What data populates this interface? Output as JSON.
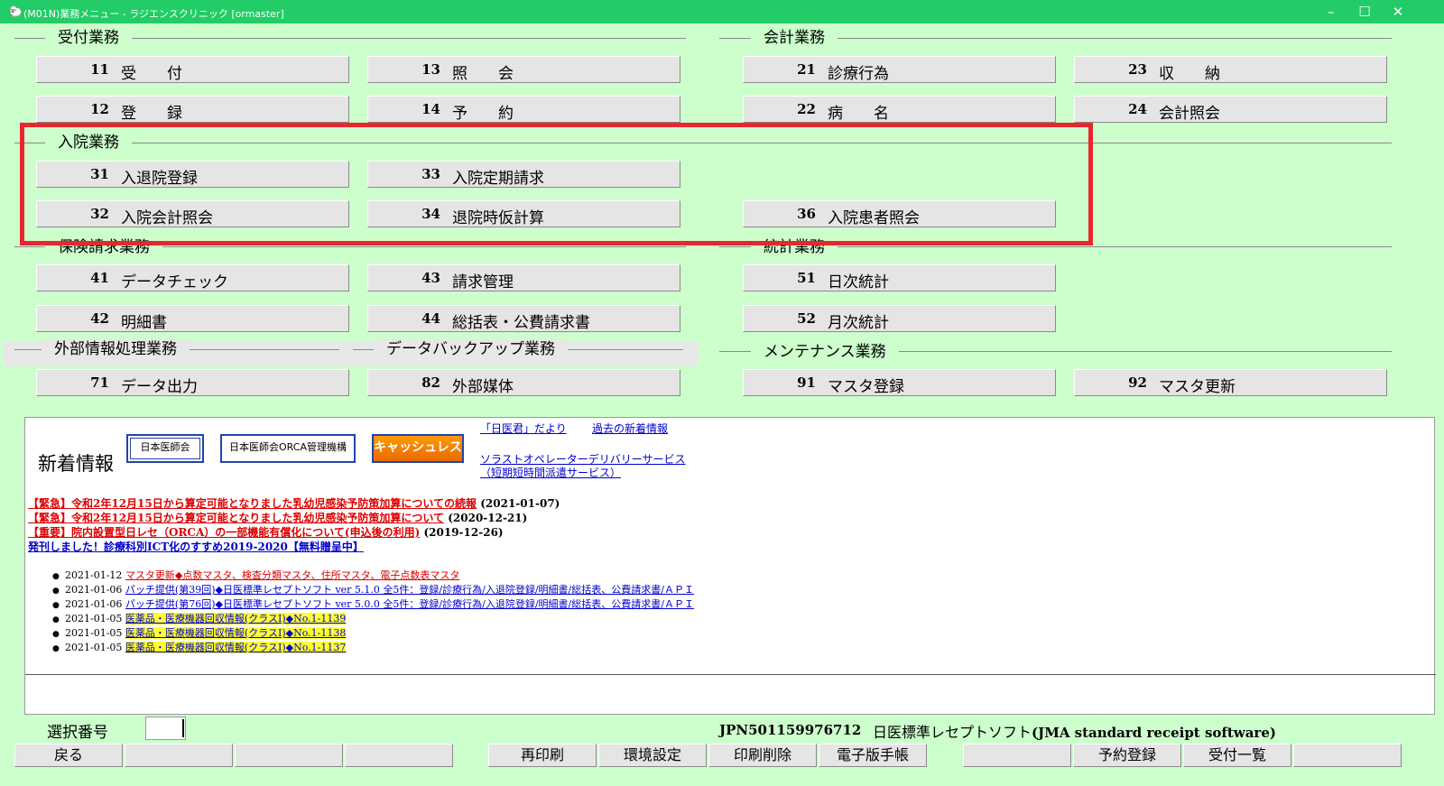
{
  "window": {
    "title": "(M01N)業務メニュー - ラジエンスクリニック [ormaster]",
    "minimize": "–",
    "maximize": "☐",
    "close": "✕"
  },
  "sections": {
    "uketsuke": "受付業務",
    "kaikei": "会計業務",
    "nyuin": "入院業務",
    "hoken": "保険請求業務",
    "tokei": "統計業務",
    "gaibu": "外部情報処理業務",
    "backup": "データバックアップ業務",
    "maintenance": "メンテナンス業務"
  },
  "buttons": {
    "b11": {
      "num": "11",
      "label": "受　　付"
    },
    "b13": {
      "num": "13",
      "label": "照　　会"
    },
    "b21": {
      "num": "21",
      "label": "診療行為"
    },
    "b23": {
      "num": "23",
      "label": "収　　納"
    },
    "b12": {
      "num": "12",
      "label": "登　　録"
    },
    "b14": {
      "num": "14",
      "label": "予　　約"
    },
    "b22": {
      "num": "22",
      "label": "病　　名"
    },
    "b24": {
      "num": "24",
      "label": "会計照会"
    },
    "b31": {
      "num": "31",
      "label": "入退院登録"
    },
    "b33": {
      "num": "33",
      "label": "入院定期請求"
    },
    "b32": {
      "num": "32",
      "label": "入院会計照会"
    },
    "b34": {
      "num": "34",
      "label": "退院時仮計算"
    },
    "b36": {
      "num": "36",
      "label": "入院患者照会"
    },
    "b41": {
      "num": "41",
      "label": "データチェック"
    },
    "b43": {
      "num": "43",
      "label": "請求管理"
    },
    "b51": {
      "num": "51",
      "label": "日次統計"
    },
    "b42": {
      "num": "42",
      "label": "明細書"
    },
    "b44": {
      "num": "44",
      "label": "総括表・公費請求書"
    },
    "b52": {
      "num": "52",
      "label": "月次統計"
    },
    "b71": {
      "num": "71",
      "label": "データ出力"
    },
    "b82": {
      "num": "82",
      "label": "外部媒体"
    },
    "b91": {
      "num": "91",
      "label": "マスタ登録"
    },
    "b92": {
      "num": "92",
      "label": "マスタ更新"
    }
  },
  "news": {
    "title": "新着情報",
    "logo_jma": "日本医師会",
    "logo_orca": "日本医師会ORCA管理機構",
    "logo_cashless": "キャッシュレス",
    "link_nichii": "「日医君」だより",
    "link_past": "過去の新着情報",
    "link_solo": "ソラストオペレーターデリバリーサービス",
    "link_solo2": "（短期短時間派遣サービス）",
    "headlines": [
      {
        "text": "【緊急】令和2年12月15日から算定可能となりました乳幼児感染予防策加算についての続報",
        "date": "(2021-01-07)"
      },
      {
        "text": "【緊急】令和2年12月15日から算定可能となりました乳幼児感染予防策加算について",
        "date": "(2020-12-21)"
      },
      {
        "text": "【重要】院内設置型日レセ（ORCA）の一部機能有償化について(申込後の利用)",
        "date": "(2019-12-26)"
      },
      {
        "text": "発刊しました！診療科別ICT化のすすめ2019-2020【無料贈呈中】",
        "date": ""
      }
    ],
    "items": [
      {
        "date": "2021-01-12",
        "text": "マスタ更新◆点数マスタ、検査分類マスタ、住所マスタ、電子点数表マスタ"
      },
      {
        "date": "2021-01-06",
        "text": "パッチ提供(第39回)◆日医標準レセプトソフト ver 5.1.0 全5件：登録/診療行為/入退院登録/明細書/総括表、公費請求書/ＡＰＩ"
      },
      {
        "date": "2021-01-06",
        "text": "パッチ提供(第76回)◆日医標準レセプトソフト ver 5.0.0 全5件：登録/診療行為/入退院登録/明細書/総括表、公費請求書/ＡＰＩ"
      },
      {
        "date": "2021-01-05",
        "text": "医薬品・医療機器回収情報(クラスⅠ)◆No.1-1139"
      },
      {
        "date": "2021-01-05",
        "text": "医薬品・医療機器回収情報(クラスⅠ)◆No.1-1138"
      },
      {
        "date": "2021-01-05",
        "text": "医薬品・医療機器回収情報(クラスⅠ)◆No.1-1137"
      }
    ]
  },
  "bottom": {
    "select_label": "選択番号",
    "select_value": "",
    "system_id": "JPN501159976712",
    "product_name": "日医標準レセプトソフト",
    "product_name_en": "(JMA standard receipt software)"
  },
  "fkeys": [
    "戻る",
    "",
    "",
    "",
    "再印刷",
    "環境設定",
    "印刷削除",
    "電子版手帳",
    "",
    "予約登録",
    "受付一覧",
    ""
  ],
  "colors": {
    "background": "#ccffcc",
    "titlebar": "#22cc66",
    "highlight": "#e8262e",
    "button": "#e5e5e5"
  }
}
